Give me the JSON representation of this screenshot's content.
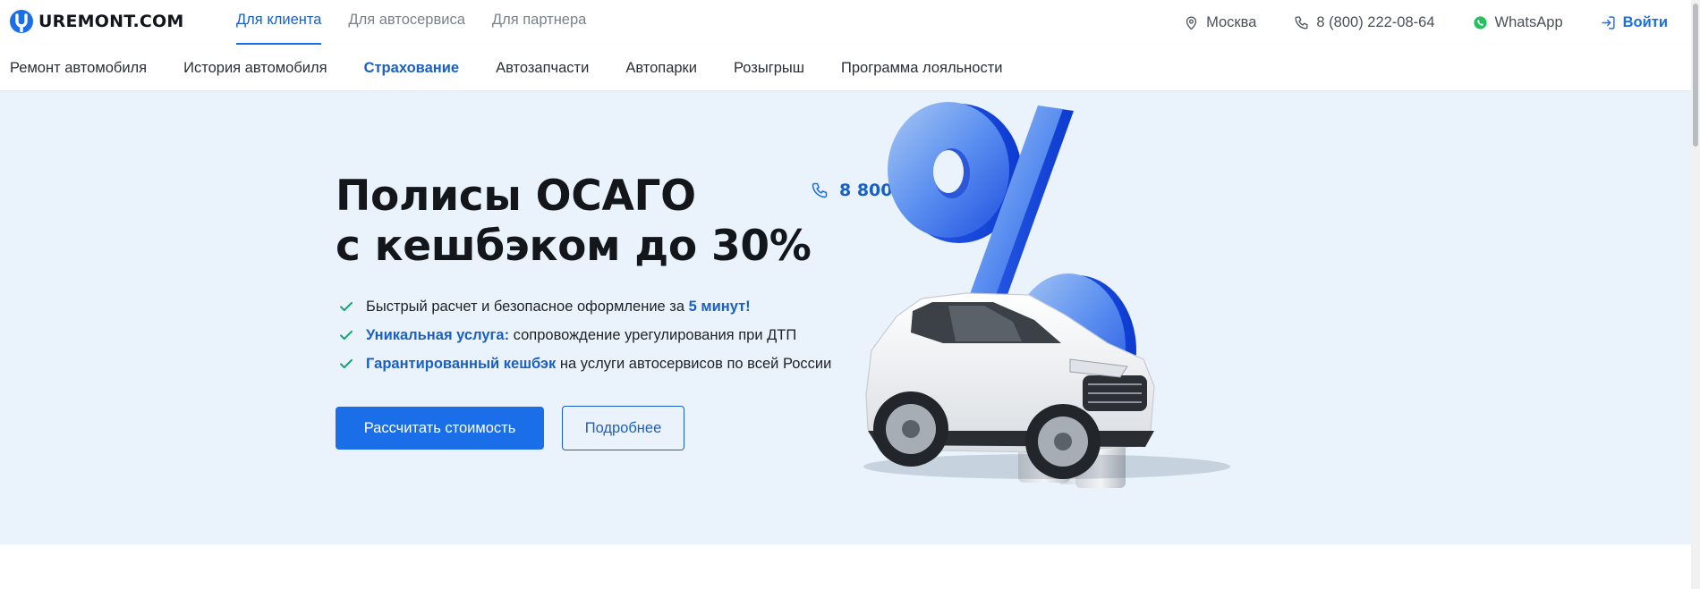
{
  "header": {
    "logo_text": "UREMONT.COM",
    "tabs": [
      {
        "label": "Для клиента",
        "active": true
      },
      {
        "label": "Для автосервиса",
        "active": false
      },
      {
        "label": "Для партнера",
        "active": false
      }
    ],
    "city": "Москва",
    "phone": "8 (800) 222-08-64",
    "whatsapp": "WhatsApp",
    "login": "Войти"
  },
  "subnav": {
    "items": [
      {
        "label": "Ремонт автомобиля",
        "active": false
      },
      {
        "label": "История автомобиля",
        "active": false
      },
      {
        "label": "Страхование",
        "active": true
      },
      {
        "label": "Автозапчасти",
        "active": false
      },
      {
        "label": "Автопарки",
        "active": false
      },
      {
        "label": "Розыгрыш",
        "active": false
      },
      {
        "label": "Программа лояльности",
        "active": false
      }
    ]
  },
  "hero": {
    "title_line1": "Полисы ОСАГО",
    "title_line2": "с кешбэком до 30%",
    "phone": "8 800 222 08 64",
    "features": [
      {
        "pre": "Быстрый расчет и безопасное оформление за ",
        "bold": "5 минут!",
        "post": ""
      },
      {
        "pre": "",
        "bold": "Уникальная услуга:",
        "post": " сопровождение урегулирования при ДТП"
      },
      {
        "pre": "",
        "bold": "Гарантированный кешбэк",
        "post": " на услуги автосервисов по всей России"
      }
    ],
    "primary_button": "Рассчитать стоимость",
    "secondary_button": "Подробнее"
  },
  "icons": {
    "location": "map-pin-icon",
    "phone": "phone-icon",
    "whatsapp": "whatsapp-icon",
    "login": "login-icon",
    "check": "check-icon"
  },
  "colors": {
    "accent": "#1a6ee8",
    "accent_text": "#1a5fc4",
    "hero_bg": "#eaf3fc",
    "check": "#1aa37a",
    "whatsapp": "#25c05f"
  }
}
